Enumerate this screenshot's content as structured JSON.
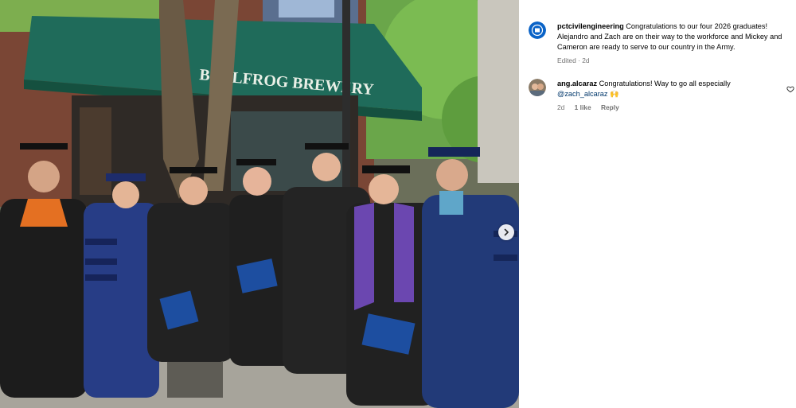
{
  "photo": {
    "description_icon": "photo",
    "awning_text": "BULLFROG BREWERY",
    "next_icon": "chevron-right-icon"
  },
  "caption": {
    "username": "pctcivilengineering",
    "text": " Congratulations to our four 2026 graduates! Alejandro and Zach are on their way to the workforce and Mickey and Cameron are ready to serve to our country in the Army.",
    "meta": "Edited · 2d"
  },
  "comments": [
    {
      "username": "ang.alcaraz",
      "text": " Congratulations! Way to go all especially ",
      "mention": "@zach_alcaraz",
      "emoji": "🙌",
      "time": "2d",
      "likes": "1 like",
      "reply": "Reply"
    }
  ],
  "colors": {
    "brand": "#0a63c7",
    "link": "#00376b",
    "meta": "#737373"
  }
}
